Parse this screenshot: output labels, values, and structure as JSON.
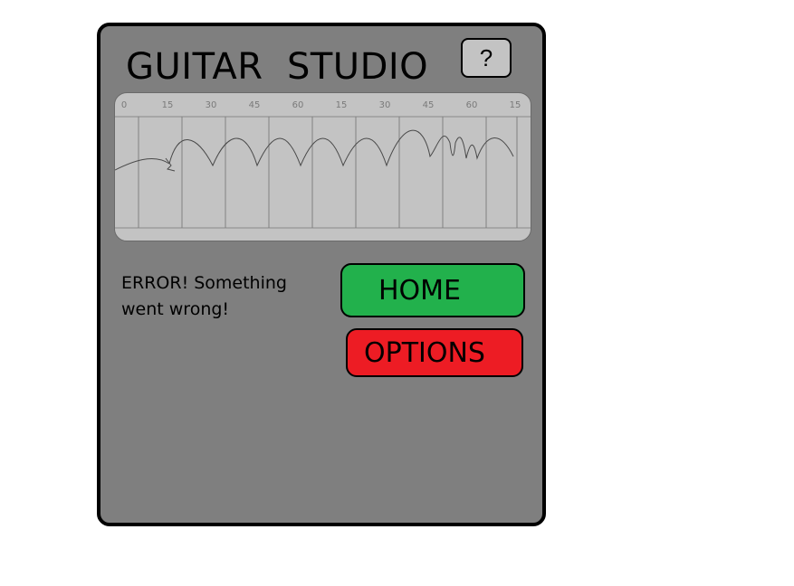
{
  "app": {
    "title": "GUITAR  STUDIO",
    "help_label": "?"
  },
  "timeline": {
    "tick_labels": [
      "0",
      "15",
      "30",
      "45",
      "60",
      "15",
      "30",
      "45",
      "60",
      "15"
    ]
  },
  "error_message": "ERROR! Something went wrong!",
  "buttons": {
    "home_label": "HOME",
    "options_label": "OPTIONS"
  },
  "colors": {
    "panel": "#7f7f7f",
    "home": "#22b14c",
    "options": "#ed1c24",
    "timeline_bg": "#c3c3c3"
  }
}
